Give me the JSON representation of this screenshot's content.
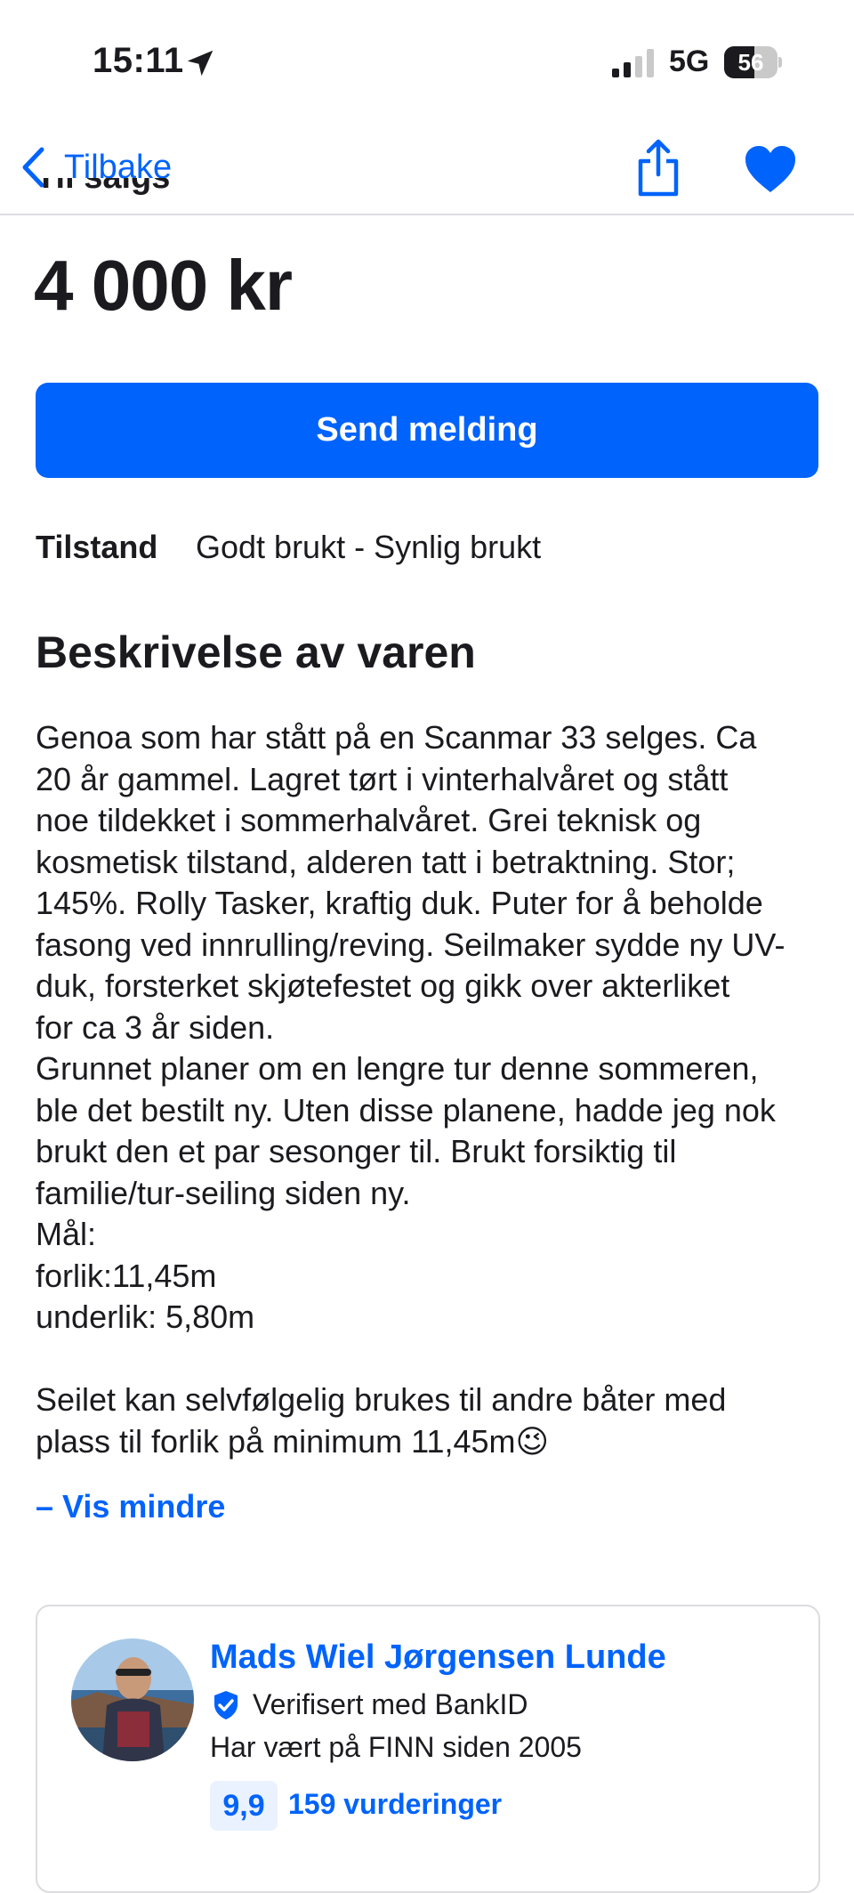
{
  "status_bar": {
    "time": "15:11",
    "network": "5G",
    "battery_level": "56",
    "battery_fraction": 0.56
  },
  "nav": {
    "back_label": "Tilbake",
    "accent_color": "#0063fb"
  },
  "listing": {
    "status_label": "Til salgs",
    "price": "4 000 kr",
    "send_button_label": "Send melding",
    "condition_label": "Tilstand",
    "condition_value": "Godt brukt - Synlig brukt",
    "description_title": "Beskrivelse av varen",
    "description": "Genoa som har stått på en Scanmar 33 selges. Ca\n20 år gammel. Lagret tørt i vinterhalvåret og stått\nnoe tildekket i sommerhalvåret. Grei teknisk og\nkosmetisk tilstand, alderen tatt i betraktning. Stor;\n145%. Rolly Tasker, kraftig duk. Puter for å beholde\nfasong ved innrulling/reving. Seilmaker sydde ny UV-\nduk, forsterket skjøtefestet og gikk over akterliket\nfor ca 3 år siden.\nGrunnet planer om en lengre tur denne sommeren,\nble det bestilt ny. Uten disse planene, hadde jeg nok\nbrukt den et par sesonger til. Brukt forsiktig til\nfamilie/tur-seiling siden ny.\nMål:\nforlik:11,45m\nunderlik: 5,80m\n\nSeilet kan selvfølgelig brukes til andre båter med\nplass til forlik på minimum 11,45m😉",
    "show_less_label": "– Vis mindre"
  },
  "seller": {
    "name": "Mads Wiel Jørgensen Lunde",
    "verified_text": "Verifisert med BankID",
    "member_since": "Har vært på FINN siden 2005",
    "score": "9,9",
    "reviews": "159 vurderinger"
  }
}
